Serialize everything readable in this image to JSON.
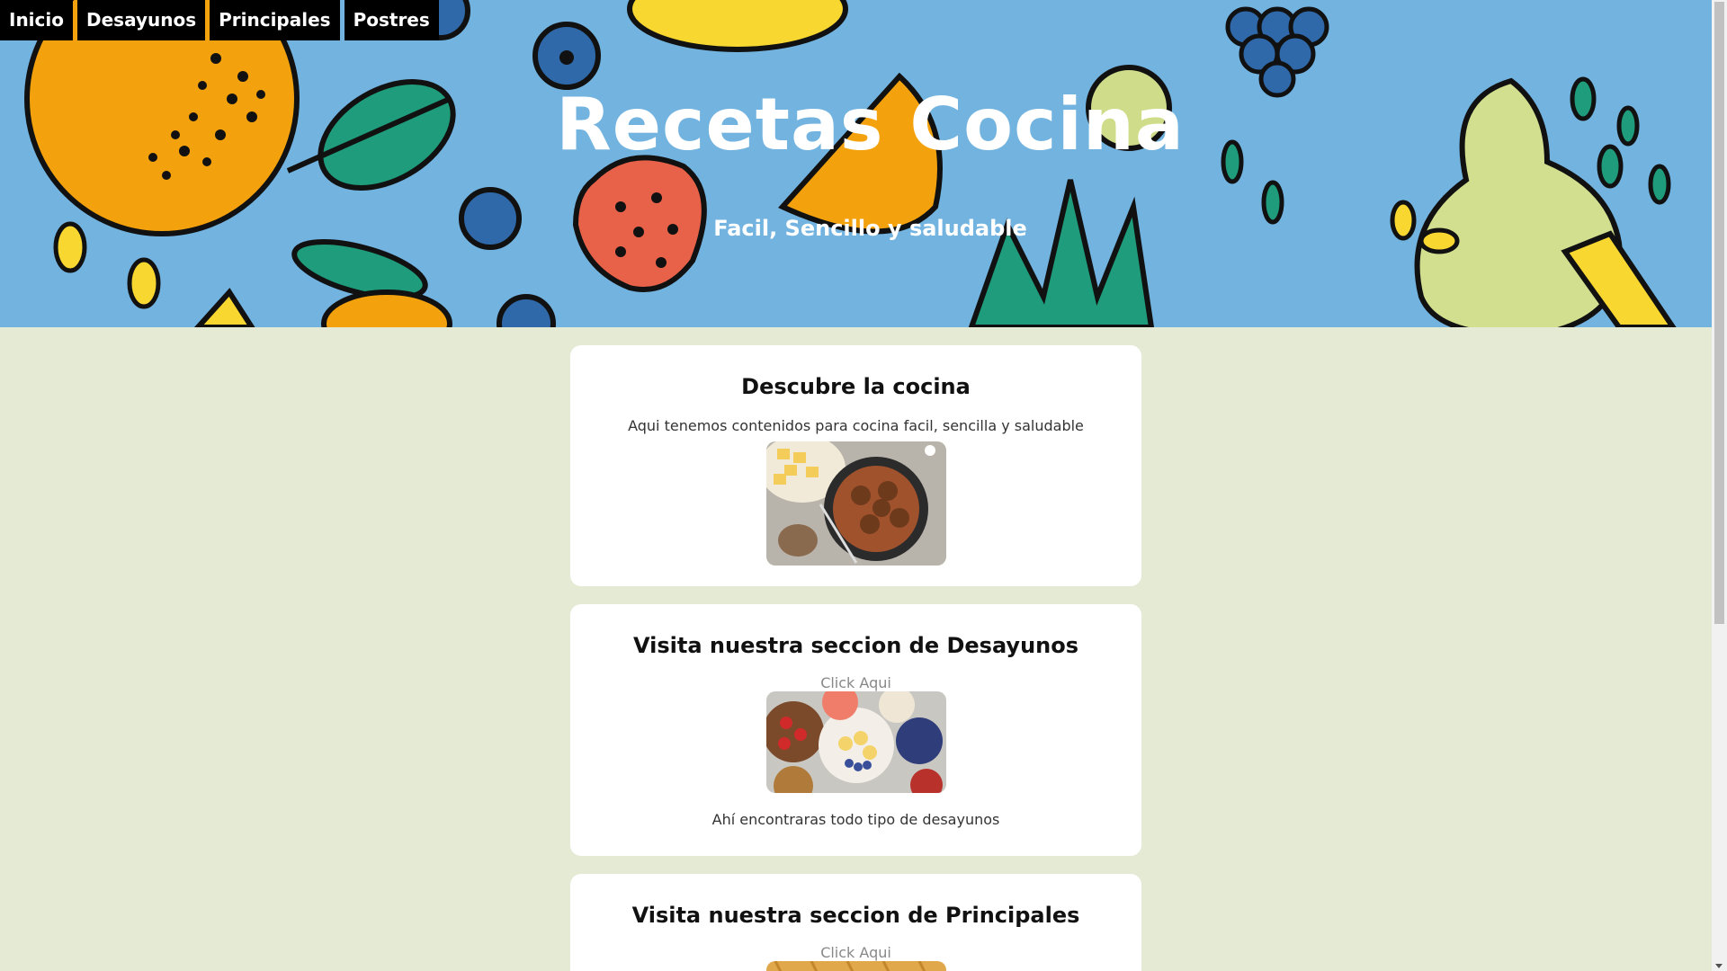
{
  "nav": {
    "items": [
      {
        "label": "Inicio"
      },
      {
        "label": "Desayunos"
      },
      {
        "label": "Principales"
      },
      {
        "label": "Postres"
      }
    ]
  },
  "hero": {
    "title": "Recetas Cocina",
    "subtitle": "Facil, Sencillo y saludable",
    "background_color": "#72b3e0"
  },
  "cards": [
    {
      "title": "Descubre la cocina",
      "description": "Aqui tenemos contenidos para cocina facil, sencilla y saludable",
      "image_icon": "meatball-stew-image"
    },
    {
      "title": "Visita nuestra seccion de Desayunos",
      "link": "Click Aqui",
      "image_icon": "breakfast-bowls-image",
      "caption": "Ahí encontraras todo tipo de desayunos"
    },
    {
      "title": "Visita nuestra seccion de Principales",
      "link": "Click Aqui",
      "image_icon": "pasta-image"
    }
  ],
  "colors": {
    "page_bg": "#e4ead3",
    "card_bg": "#ffffff",
    "nav_bg": "#000000",
    "nav_text": "#ffffff",
    "link_text": "#888888"
  }
}
